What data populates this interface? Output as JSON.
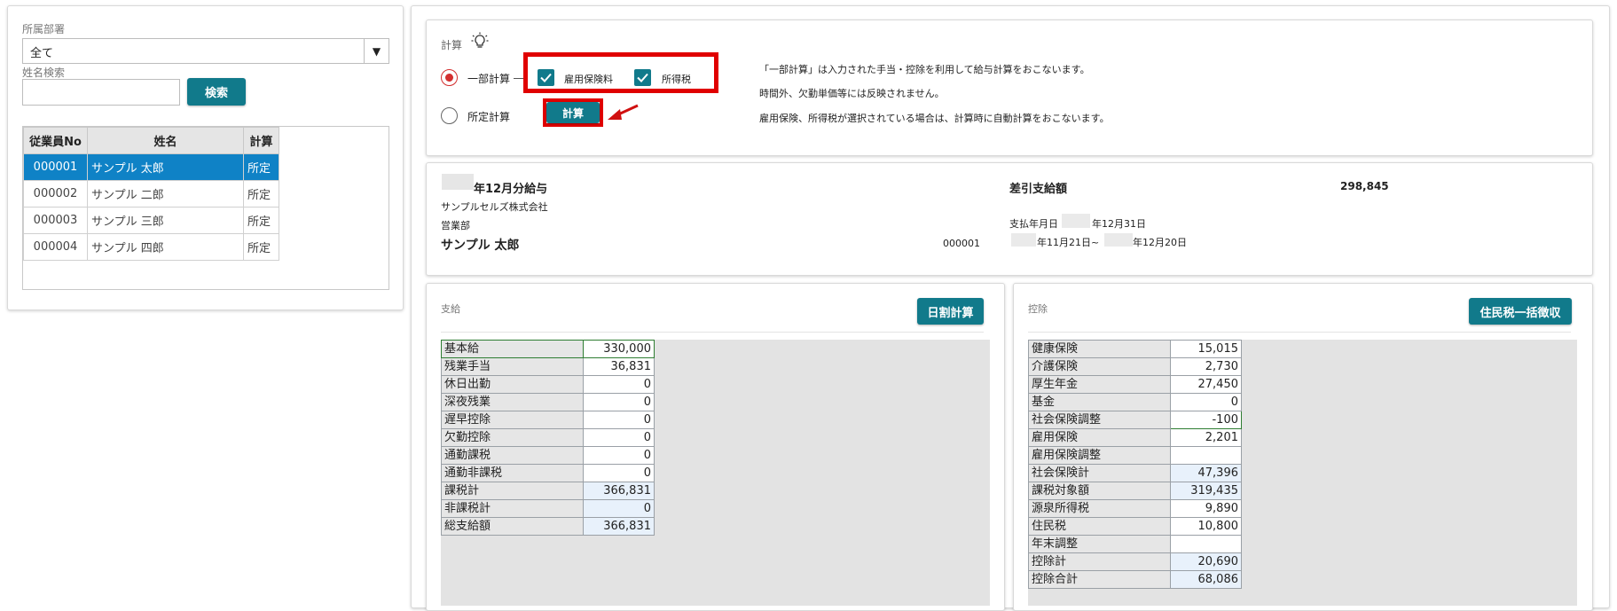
{
  "sidebar": {
    "department_label": "所属部署",
    "department_value": "全て",
    "name_search_label": "姓名検索",
    "name_search_value": "",
    "search_button": "検索",
    "table": {
      "headers": [
        "従業員No",
        "姓名",
        "計算"
      ],
      "rows": [
        {
          "no": "000001",
          "name": "サンプル 太郎",
          "calc": "所定"
        },
        {
          "no": "000002",
          "name": "サンプル 二郎",
          "calc": "所定"
        },
        {
          "no": "000003",
          "name": "サンプル 三郎",
          "calc": "所定"
        },
        {
          "no": "000004",
          "name": "サンプル 四郎",
          "calc": "所定"
        }
      ]
    }
  },
  "calc": {
    "title": "計算",
    "option_partial": "一部計算",
    "option_standard": "所定計算",
    "check_employment": "雇用保険料",
    "check_income_tax": "所得税",
    "calc_button": "計算",
    "desc_1": "「一部計算」は入力された手当・控除を利用して給与計算をおこないます。",
    "desc_2": "時間外、欠勤単価等には反映されません。",
    "desc_3": "雇用保険、所得税が選択されている場合は、計算時に自動計算をおこないます。"
  },
  "summary": {
    "period_title": "年12月分給与",
    "company": "サンプルセルズ株式会社",
    "department": "営業部",
    "employee_name": "サンプル 太郎",
    "employee_no": "000001",
    "net_pay_label": "差引支給額",
    "net_pay_value": "298,845",
    "pay_date_prefix": "支払年月日",
    "pay_date_suffix": "年12月31日",
    "period_range_a": "年11月21日~",
    "period_range_b": "年12月20日"
  },
  "payments": {
    "title": "支給",
    "button": "日割計算",
    "rows": [
      {
        "label": "基本給",
        "value": "330,000"
      },
      {
        "label": "残業手当",
        "value": "36,831"
      },
      {
        "label": "休日出勤",
        "value": "0"
      },
      {
        "label": "深夜残業",
        "value": "0"
      },
      {
        "label": "遅早控除",
        "value": "0"
      },
      {
        "label": "欠勤控除",
        "value": "0"
      },
      {
        "label": "通勤課税",
        "value": "0"
      },
      {
        "label": "通勤非課税",
        "value": "0"
      },
      {
        "label": "課税計",
        "value": "366,831"
      },
      {
        "label": "非課税計",
        "value": "0"
      },
      {
        "label": "総支給額",
        "value": "366,831"
      }
    ]
  },
  "deductions": {
    "title": "控除",
    "button": "住民税一括徴収",
    "rows": [
      {
        "label": "健康保険",
        "value": "15,015"
      },
      {
        "label": "介護保険",
        "value": "2,730"
      },
      {
        "label": "厚生年金",
        "value": "27,450"
      },
      {
        "label": "基金",
        "value": "0"
      },
      {
        "label": "社会保険調整",
        "value": "-100"
      },
      {
        "label": "雇用保険",
        "value": "2,201"
      },
      {
        "label": "雇用保険調整",
        "value": ""
      },
      {
        "label": "社会保険計",
        "value": "47,396"
      },
      {
        "label": "課税対象額",
        "value": "319,435"
      },
      {
        "label": "源泉所得税",
        "value": "9,890"
      },
      {
        "label": "住民税",
        "value": "10,800"
      },
      {
        "label": "年末調整",
        "value": ""
      },
      {
        "label": "控除計",
        "value": "20,690"
      },
      {
        "label": "控除合計",
        "value": "68,086"
      }
    ]
  },
  "colors": {
    "accent_teal": "#117a8b",
    "highlight_red": "#e00000",
    "selected_row": "#0f82c6"
  }
}
